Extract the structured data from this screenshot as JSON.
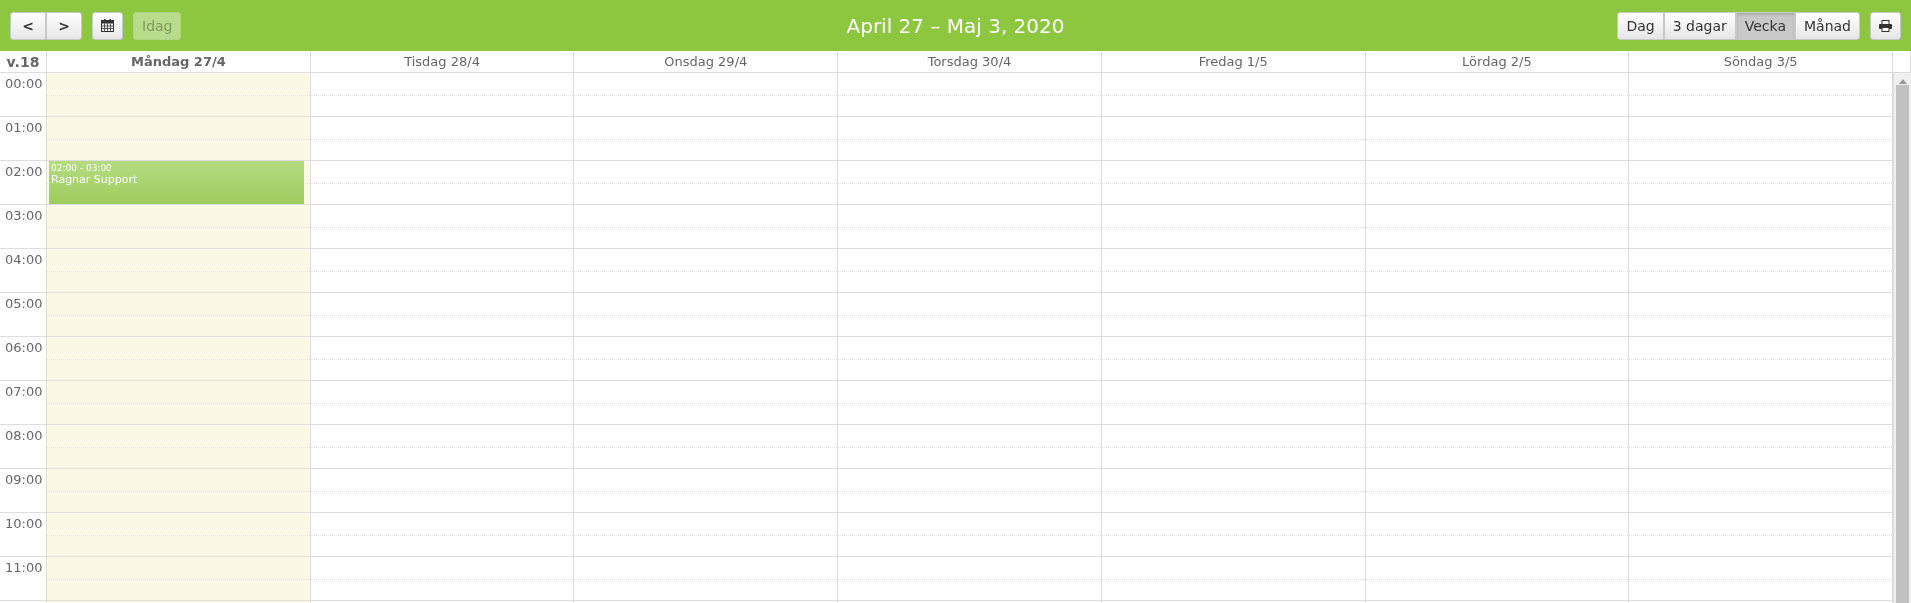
{
  "toolbar": {
    "title": "April 27 – Maj 3, 2020",
    "prev_button": "<",
    "next_button": ">",
    "today_button": {
      "label": "Idag",
      "disabled": true
    },
    "views": [
      {
        "label": "Dag",
        "selected": false
      },
      {
        "label": "3 dagar",
        "selected": false
      },
      {
        "label": "Vecka",
        "selected": true
      },
      {
        "label": "Månad",
        "selected": false
      }
    ]
  },
  "week_label": "v.18",
  "days": [
    {
      "label": "Måndag 27/4",
      "today": true,
      "events": [
        {
          "time": "02:00 - 03:00",
          "title": "Ragnar Support"
        }
      ]
    },
    {
      "label": "Tisdag 28/4",
      "today": false
    },
    {
      "label": "Onsdag 29/4",
      "today": false
    },
    {
      "label": "Torsdag 30/4",
      "today": false
    },
    {
      "label": "Fredag 1/5",
      "today": false
    },
    {
      "label": "Lördag 2/5",
      "today": false
    },
    {
      "label": "Söndag 3/5",
      "today": false
    }
  ],
  "hours": [
    "00:00",
    "01:00",
    "02:00",
    "03:00",
    "04:00",
    "05:00",
    "06:00",
    "07:00",
    "08:00",
    "09:00",
    "10:00",
    "11:00"
  ]
}
